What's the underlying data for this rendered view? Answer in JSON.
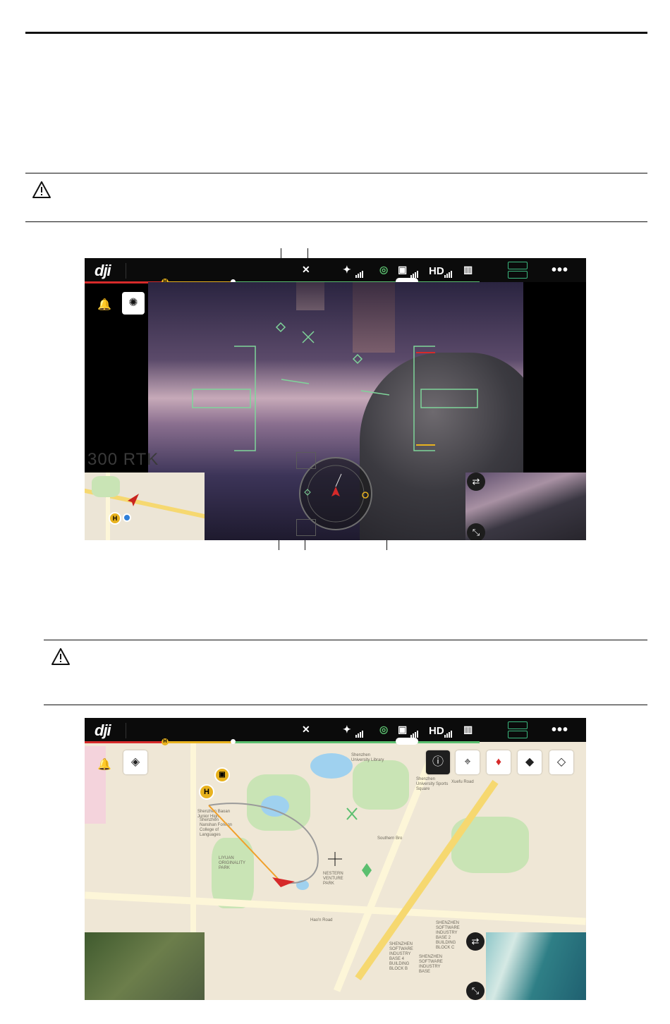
{
  "figure1": {
    "topbar": {
      "logo": "dji",
      "hd_label": "HD",
      "more_label": "•••"
    },
    "progress": {
      "home_marker": "H"
    },
    "camera": {
      "model_text": "300 RTK"
    }
  },
  "figure2": {
    "topbar": {
      "logo": "dji",
      "hd_label": "HD",
      "more_label": "•••"
    },
    "progress": {
      "home_marker": "H"
    },
    "map": {
      "home_marker": "H",
      "labels": [
        "Shenzhen University Library",
        "Shenzhen University Sports Square",
        "Shenzhen Baoan Junior High",
        "Shenzhen Nanshan Foreign College of Languages",
        "LIYUAN ORIGINALITY PARK",
        "NESTERN VENTURE PARK",
        "Southern Bro",
        "SHENZHEN SOFTWARE INDUSTRY BASE 4 BUILDING BLOCK B",
        "SHENZHEN SOFTWARE INDUSTRY BASE",
        "SHENZHEN SOFTWARE INDUSTRY BASE 2 BUILDING BLOCK C",
        "Xuefu Road",
        "Hao'n Road"
      ]
    }
  }
}
